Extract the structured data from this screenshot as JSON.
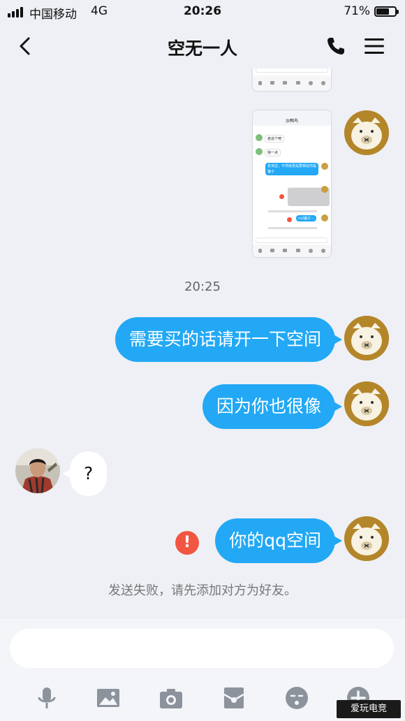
{
  "status_bar": {
    "carrier": "中国移动",
    "network": "4G",
    "time": "20:26",
    "battery_percent": "71%",
    "battery_level": 0.71
  },
  "nav": {
    "title": "空无一人",
    "back_icon": "chevron-left-icon",
    "call_icon": "phone-icon",
    "menu_icon": "menu-icon"
  },
  "thumbnail": {
    "header_title": "沙鸭鸟",
    "messages": [
      "走这个吧",
      "快一点",
      "走淘宝，不然就更是要相信你是骗子",
      "ro2骗子..."
    ],
    "fail_note": "发送失败，请先添加对方为好友。"
  },
  "messages": [
    {
      "type": "time",
      "text": "20:25"
    },
    {
      "type": "outgoing",
      "text": "需要买的话请开一下空间"
    },
    {
      "type": "outgoing",
      "text": "因为你也很像"
    },
    {
      "type": "incoming",
      "text": "?"
    },
    {
      "type": "outgoing",
      "text": "你的qq空间",
      "failed": true
    }
  ],
  "error_mark": "!",
  "fail_note": "发送失败，请先添加对方为好友。",
  "toolbar": [
    "microphone-icon",
    "image-icon",
    "camera-icon",
    "red-packet-icon",
    "emoji-icon",
    "plus-icon"
  ],
  "watermark": "爱玩电竞",
  "colors": {
    "bubble_outgoing": "#22a8f5",
    "bubble_incoming": "#ffffff",
    "background": "#eef0f5",
    "error": "#f25643"
  }
}
